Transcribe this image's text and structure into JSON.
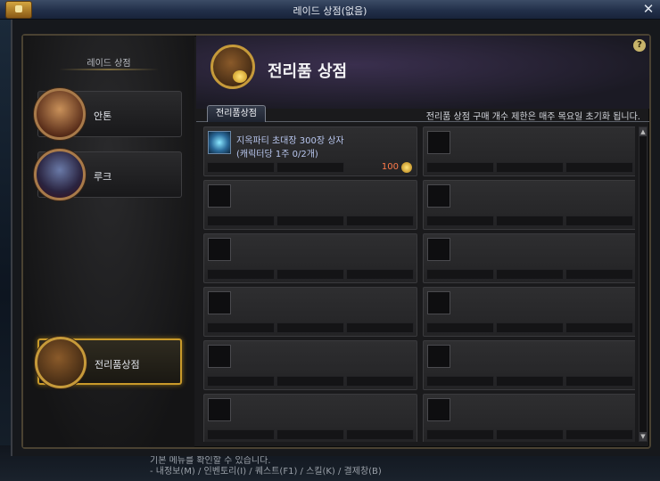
{
  "window": {
    "title": "레이드 상점(없음)"
  },
  "left_panel": {
    "title": "레이드 상점",
    "npcs": [
      {
        "label": "안톤",
        "portrait": "anton-portrait-icon"
      },
      {
        "label": "루크",
        "portrait": "luke-portrait-icon"
      }
    ],
    "bottom_button": {
      "label": "전리품상점",
      "icon": "loot-bag-icon"
    }
  },
  "header": {
    "title": "전리품 상점",
    "help": "?"
  },
  "tabs": [
    {
      "label": "전리품상점",
      "selected": true
    }
  ],
  "notice": "전리품 상점 구매 개수 제한은 매주 목요일 초기화 됩니다.",
  "items": [
    {
      "name": "지옥파티 초대장 300장 상자",
      "limit": "(캐릭터당 1주 0/2개)",
      "price": "100",
      "currency_icon": "coin-icon"
    }
  ],
  "scroll": {
    "up": "▲",
    "down": "▼"
  },
  "game_hint": {
    "line1": "기본 메뉴를 확인할 수 있습니다.",
    "line2": "- 내정보(M) / 인벤토리(I) / 퀘스트(F1) / 스킬(K) / 결제창(B)"
  },
  "colors": {
    "accent_gold": "#c99a2a",
    "price": "#ff7a4a",
    "item_text": "#b8c6ee"
  }
}
